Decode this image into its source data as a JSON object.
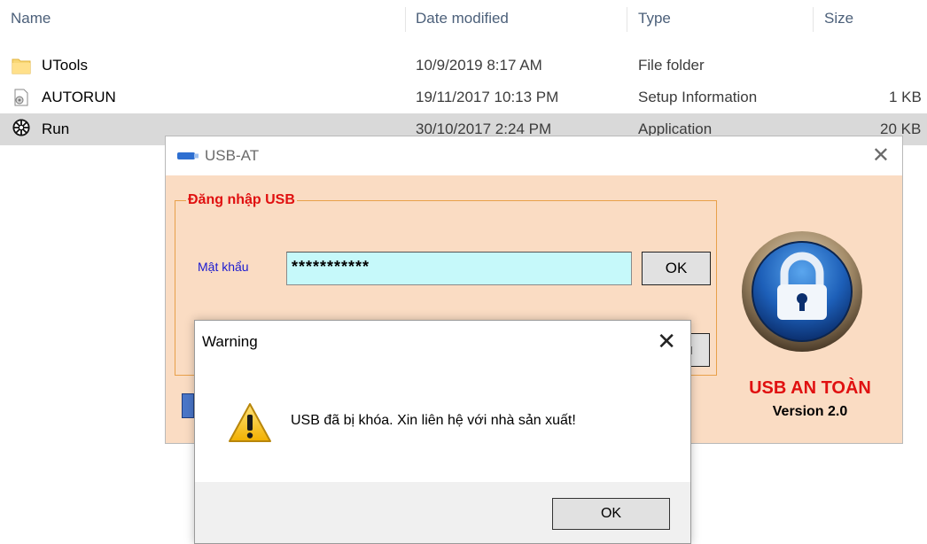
{
  "explorer": {
    "columns": {
      "name": "Name",
      "date": "Date modified",
      "type": "Type",
      "size": "Size"
    },
    "rows": [
      {
        "name": "UTools",
        "date": "10/9/2019 8:17 AM",
        "type": "File folder",
        "size": "",
        "icon": "folder-icon"
      },
      {
        "name": "AUTORUN",
        "date": "19/11/2017 10:13 PM",
        "type": "Setup Information",
        "size": "1 KB",
        "icon": "setup-info-icon"
      },
      {
        "name": "Run",
        "date": "30/10/2017 2:24 PM",
        "type": "Application",
        "size": "20 KB",
        "icon": "application-icon"
      }
    ]
  },
  "usb_window": {
    "title": "USB-AT",
    "group_title": "Đăng nhập USB",
    "password_label": "Mật khẩu",
    "password_value": "***********",
    "ok_label": "OK",
    "hidden_button_label": "u",
    "brand_name": "USB AN TOÀN",
    "version": "Version 2.0"
  },
  "warning": {
    "title": "Warning",
    "message": "USB đã bị khóa. Xin liên hệ với nhà sản xuất!",
    "ok_label": "OK"
  },
  "colors": {
    "window_bg": "#fadcc3",
    "group_title": "#e01010",
    "label_blue": "#1a1ad0",
    "input_bg": "#c6f9fa",
    "selected_row": "#d9d9d9"
  }
}
